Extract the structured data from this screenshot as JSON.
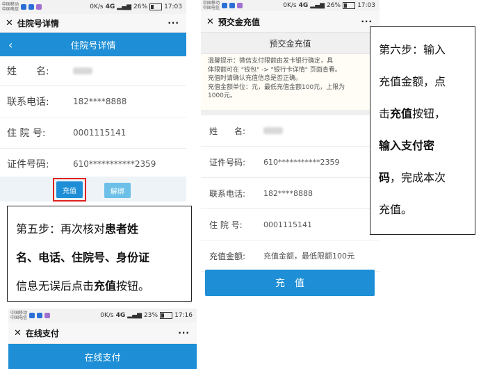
{
  "status_bar_1": {
    "carrier1": "中国移动",
    "carrier2": "中国电信",
    "speed": "0K/s",
    "net": "4G",
    "battery": "26%",
    "time": "17:03"
  },
  "status_bar_2": {
    "carrier1": "中国移动",
    "carrier2": "中国电信",
    "speed": "0K/s",
    "net": "4G",
    "battery": "26%",
    "time": "17:03"
  },
  "status_bar_3": {
    "carrier1": "中国移动",
    "carrier2": "中国电信",
    "speed": "0K/s",
    "net": "4G",
    "battery": "23%",
    "time": "17:16"
  },
  "screen1": {
    "wx_title": "住院号详情",
    "header_title": "住院号详情",
    "rows": [
      {
        "label": "姓　　名:",
        "value": ""
      },
      {
        "label": "联系电话:",
        "value": "182****8888"
      },
      {
        "label": "住 院 号:",
        "value": "0001115141"
      },
      {
        "label": "证件号码:",
        "value": "610***********2359"
      }
    ],
    "recharge_button": "充值",
    "unbind_button": "解绑"
  },
  "callout_step5": {
    "p1": "第五步：再次核对",
    "b1": "患者姓",
    "b2": "名、电话、住院号、身份证",
    "p2": "信息无误后点击",
    "b3": "充值",
    "p3": "按钮。"
  },
  "screen2": {
    "wx_title": "预交金充值",
    "header_title": "预交金充值",
    "tip_lines": [
      "温馨提示：微信支付限额由发卡银行确定，具",
      "体限额可在 \"钱包\" -> \"银行卡详情\" 页面查看。",
      "充值时请确认充值信息是否正确。",
      "充值金额单位：元，最低充值金额100元，上限为",
      "1000元。"
    ],
    "rows": [
      {
        "label": "姓　　名:",
        "value": ""
      },
      {
        "label": "证件号码:",
        "value": "610***********2359"
      },
      {
        "label": "联系电话:",
        "value": "182****8888"
      },
      {
        "label": "住 院 号:",
        "value": "0001115141"
      },
      {
        "label": "充值金额:",
        "value": "充值金额，最低限额100元"
      }
    ],
    "submit_button": "充　值"
  },
  "callout_step6": {
    "p1": "第六步：输入",
    "p2": "充值金额，点",
    "p3": "击",
    "b1": "充值",
    "p4": "按钮，",
    "b2": "输入支付密",
    "b3": "码",
    "p5": "，完成本次",
    "p6": "充值。"
  },
  "screen3": {
    "wx_title": "在线支付",
    "header_title": "在线支付"
  },
  "colors": {
    "accent": "#1e8fd6",
    "highlight": "#e02020",
    "unbind": "#6cc0e8"
  }
}
